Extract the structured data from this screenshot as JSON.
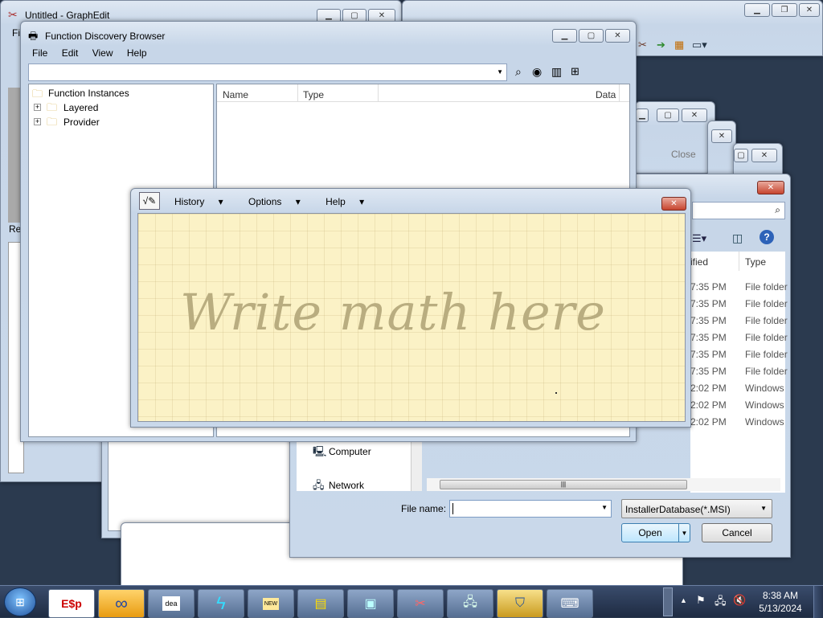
{
  "graphedit": {
    "title": "Untitled - GraphEdit",
    "menu_stub": "Fi",
    "status_stub": "Rea"
  },
  "fdb": {
    "title": "Function Discovery Browser",
    "menu": [
      "File",
      "Edit",
      "View",
      "Help"
    ],
    "tree_root": "Function Instances",
    "tree_items": [
      "Layered",
      "Provider"
    ],
    "columns": [
      "Name",
      "Type",
      "Data"
    ]
  },
  "back_window": {
    "close_label": "Close"
  },
  "math": {
    "menu": [
      "History",
      "Options",
      "Help"
    ],
    "placeholder": "Write math here"
  },
  "file_dialog": {
    "col_modified": "ified",
    "col_type": "Type",
    "rows": [
      {
        "time": "7:35 PM",
        "type": "File folder"
      },
      {
        "time": "7:35 PM",
        "type": "File folder"
      },
      {
        "time": "7:35 PM",
        "type": "File folder"
      },
      {
        "time": "7:35 PM",
        "type": "File folder"
      },
      {
        "time": "7:35 PM",
        "type": "File folder"
      },
      {
        "time": "7:35 PM",
        "type": "File folder"
      },
      {
        "time": "2:02 PM",
        "type": "Windows"
      },
      {
        "time": "2:02 PM",
        "type": "Windows"
      },
      {
        "time": "2:02 PM",
        "type": "Windows"
      }
    ],
    "nav": [
      "Computer",
      "Network"
    ],
    "filename_label": "File name:",
    "filename_value": "",
    "filter": "InstallerDatabase(*.MSI)",
    "open_label": "Open",
    "cancel_label": "Cancel"
  },
  "taskbar": {
    "time": "8:38 AM",
    "date": "5/13/2024",
    "apps": [
      "esp-icon",
      "infinity-icon",
      "dea-icon",
      "bolt-icon",
      "notepad-icon",
      "text-editor-icon",
      "window-icon",
      "graphedit-icon",
      "network-icon",
      "shield-icon",
      "keyboard-icon"
    ]
  },
  "colors": {
    "desktop": "#2b3a4f",
    "math_pad": "#fbf2c6",
    "taskbar": "#1e2b42"
  }
}
